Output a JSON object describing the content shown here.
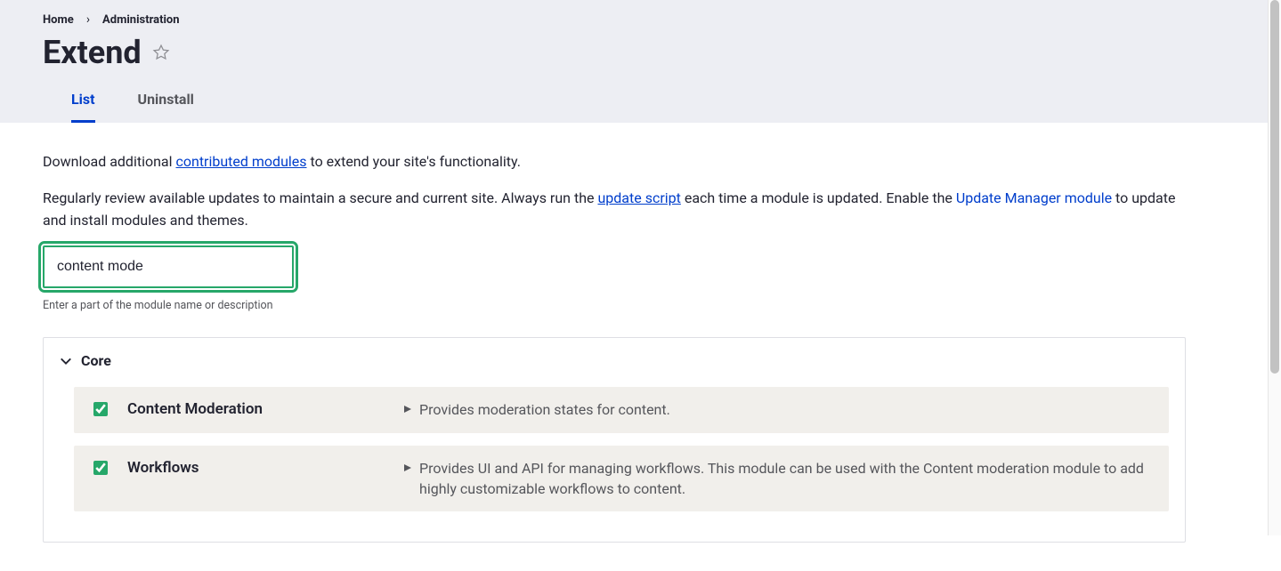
{
  "breadcrumb": {
    "home": "Home",
    "admin": "Administration"
  },
  "page_title": "Extend",
  "tabs": {
    "list": "List",
    "uninstall": "Uninstall"
  },
  "intro": {
    "p1_pre": "Download additional ",
    "p1_link": "contributed modules",
    "p1_post": " to extend your site's functionality.",
    "p2_pre": "Regularly review available updates to maintain a secure and current site. Always run the ",
    "p2_link1": "update script",
    "p2_mid": " each time a module is updated. Enable the ",
    "p2_link2": "Update Manager module",
    "p2_post": " to update and install modules and themes."
  },
  "filter": {
    "value": "content mode",
    "help": "Enter a part of the module name or description"
  },
  "section": {
    "title": "Core"
  },
  "modules": [
    {
      "name": "Content Moderation",
      "desc": "Provides moderation states for content.",
      "checked": true
    },
    {
      "name": "Workflows",
      "desc": "Provides UI and API for managing workflows. This module can be used with the Content moderation module to add highly customizable workflows to content.",
      "checked": true
    }
  ]
}
